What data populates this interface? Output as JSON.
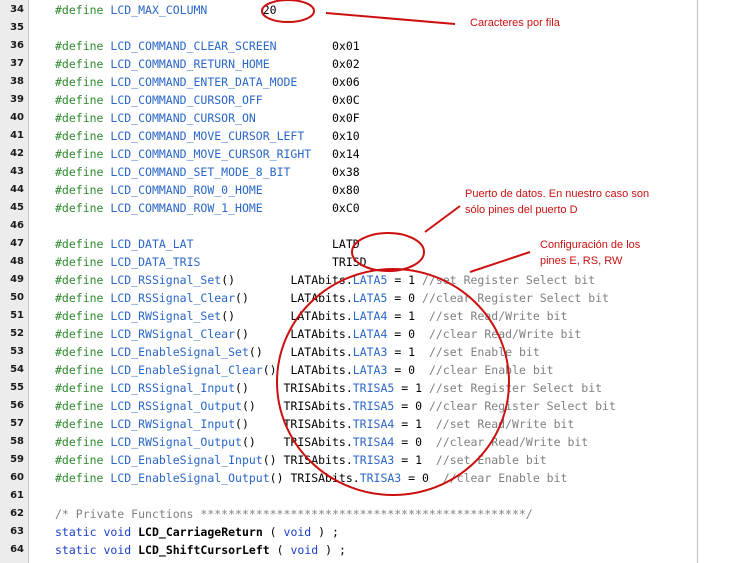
{
  "editor": {
    "lines": [
      {
        "num": "34",
        "parts": [
          [
            "def",
            "#define"
          ],
          [
            "txt",
            " "
          ],
          [
            "mac",
            "LCD_MAX_COLUMN"
          ],
          [
            "txt",
            "        "
          ],
          [
            "num",
            "20"
          ]
        ]
      },
      {
        "num": "35",
        "parts": []
      },
      {
        "num": "36",
        "parts": [
          [
            "def",
            "#define"
          ],
          [
            "txt",
            " "
          ],
          [
            "mac",
            "LCD_COMMAND_CLEAR_SCREEN"
          ],
          [
            "txt",
            "        "
          ],
          [
            "hex",
            "0x01"
          ]
        ]
      },
      {
        "num": "37",
        "parts": [
          [
            "def",
            "#define"
          ],
          [
            "txt",
            " "
          ],
          [
            "mac",
            "LCD_COMMAND_RETURN_HOME"
          ],
          [
            "txt",
            "         "
          ],
          [
            "hex",
            "0x02"
          ]
        ]
      },
      {
        "num": "38",
        "parts": [
          [
            "def",
            "#define"
          ],
          [
            "txt",
            " "
          ],
          [
            "mac",
            "LCD_COMMAND_ENTER_DATA_MODE"
          ],
          [
            "txt",
            "     "
          ],
          [
            "hex",
            "0x06"
          ]
        ]
      },
      {
        "num": "39",
        "parts": [
          [
            "def",
            "#define"
          ],
          [
            "txt",
            " "
          ],
          [
            "mac",
            "LCD_COMMAND_CURSOR_OFF"
          ],
          [
            "txt",
            "          "
          ],
          [
            "hex",
            "0x0C"
          ]
        ]
      },
      {
        "num": "40",
        "parts": [
          [
            "def",
            "#define"
          ],
          [
            "txt",
            " "
          ],
          [
            "mac",
            "LCD_COMMAND_CURSOR_ON"
          ],
          [
            "txt",
            "           "
          ],
          [
            "hex",
            "0x0F"
          ]
        ]
      },
      {
        "num": "41",
        "parts": [
          [
            "def",
            "#define"
          ],
          [
            "txt",
            " "
          ],
          [
            "mac",
            "LCD_COMMAND_MOVE_CURSOR_LEFT"
          ],
          [
            "txt",
            "    "
          ],
          [
            "hex",
            "0x10"
          ]
        ]
      },
      {
        "num": "42",
        "parts": [
          [
            "def",
            "#define"
          ],
          [
            "txt",
            " "
          ],
          [
            "mac",
            "LCD_COMMAND_MOVE_CURSOR_RIGHT"
          ],
          [
            "txt",
            "   "
          ],
          [
            "hex",
            "0x14"
          ]
        ]
      },
      {
        "num": "43",
        "parts": [
          [
            "def",
            "#define"
          ],
          [
            "txt",
            " "
          ],
          [
            "mac",
            "LCD_COMMAND_SET_MODE_8_BIT"
          ],
          [
            "txt",
            "      "
          ],
          [
            "hex",
            "0x38"
          ]
        ]
      },
      {
        "num": "44",
        "parts": [
          [
            "def",
            "#define"
          ],
          [
            "txt",
            " "
          ],
          [
            "mac",
            "LCD_COMMAND_ROW_0_HOME"
          ],
          [
            "txt",
            "          "
          ],
          [
            "hex",
            "0x80"
          ]
        ]
      },
      {
        "num": "45",
        "parts": [
          [
            "def",
            "#define"
          ],
          [
            "txt",
            " "
          ],
          [
            "mac",
            "LCD_COMMAND_ROW_1_HOME"
          ],
          [
            "txt",
            "          "
          ],
          [
            "hex",
            "0xC0"
          ]
        ]
      },
      {
        "num": "46",
        "parts": []
      },
      {
        "num": "47",
        "parts": [
          [
            "def",
            "#define"
          ],
          [
            "txt",
            " "
          ],
          [
            "mac",
            "LCD_DATA_LAT"
          ],
          [
            "txt",
            "                    "
          ],
          [
            "hex",
            "LATD"
          ]
        ]
      },
      {
        "num": "48",
        "parts": [
          [
            "def",
            "#define"
          ],
          [
            "txt",
            " "
          ],
          [
            "mac",
            "LCD_DATA_TRIS"
          ],
          [
            "txt",
            "                   "
          ],
          [
            "hex",
            "TRISD"
          ]
        ]
      },
      {
        "num": "49",
        "parts": [
          [
            "def",
            "#define"
          ],
          [
            "txt",
            " "
          ],
          [
            "mac",
            "LCD_RSSignal_Set"
          ],
          [
            "txt",
            "()        "
          ],
          [
            "reg",
            "LATAbits"
          ],
          [
            "op",
            "."
          ],
          [
            "fld",
            "LATA5"
          ],
          [
            "op",
            " = "
          ],
          [
            "num",
            "1"
          ],
          [
            "txt",
            " "
          ],
          [
            "cmt",
            "//set Register Select bit"
          ]
        ]
      },
      {
        "num": "50",
        "parts": [
          [
            "def",
            "#define"
          ],
          [
            "txt",
            " "
          ],
          [
            "mac",
            "LCD_RSSignal_Clear"
          ],
          [
            "txt",
            "()      "
          ],
          [
            "reg",
            "LATAbits"
          ],
          [
            "op",
            "."
          ],
          [
            "fld",
            "LATA5"
          ],
          [
            "op",
            " = "
          ],
          [
            "num",
            "0"
          ],
          [
            "txt",
            " "
          ],
          [
            "cmt",
            "//clear Register Select bit"
          ]
        ]
      },
      {
        "num": "51",
        "parts": [
          [
            "def",
            "#define"
          ],
          [
            "txt",
            " "
          ],
          [
            "mac",
            "LCD_RWSignal_Set"
          ],
          [
            "txt",
            "()        "
          ],
          [
            "reg",
            "LATAbits"
          ],
          [
            "op",
            "."
          ],
          [
            "fld",
            "LATA4"
          ],
          [
            "op",
            " = "
          ],
          [
            "num",
            "1"
          ],
          [
            "txt",
            "  "
          ],
          [
            "cmt",
            "//set Read/Write bit"
          ]
        ]
      },
      {
        "num": "52",
        "parts": [
          [
            "def",
            "#define"
          ],
          [
            "txt",
            " "
          ],
          [
            "mac",
            "LCD_RWSignal_Clear"
          ],
          [
            "txt",
            "()      "
          ],
          [
            "reg",
            "LATAbits"
          ],
          [
            "op",
            "."
          ],
          [
            "fld",
            "LATA4"
          ],
          [
            "op",
            " = "
          ],
          [
            "num",
            "0"
          ],
          [
            "txt",
            "  "
          ],
          [
            "cmt",
            "//clear Read/Write bit"
          ]
        ]
      },
      {
        "num": "53",
        "parts": [
          [
            "def",
            "#define"
          ],
          [
            "txt",
            " "
          ],
          [
            "mac",
            "LCD_EnableSignal_Set"
          ],
          [
            "txt",
            "()    "
          ],
          [
            "reg",
            "LATAbits"
          ],
          [
            "op",
            "."
          ],
          [
            "fld",
            "LATA3"
          ],
          [
            "op",
            " = "
          ],
          [
            "num",
            "1"
          ],
          [
            "txt",
            "  "
          ],
          [
            "cmt",
            "//set Enable bit"
          ]
        ]
      },
      {
        "num": "54",
        "parts": [
          [
            "def",
            "#define"
          ],
          [
            "txt",
            " "
          ],
          [
            "mac",
            "LCD_EnableSignal_Clear"
          ],
          [
            "txt",
            "()  "
          ],
          [
            "reg",
            "LATAbits"
          ],
          [
            "op",
            "."
          ],
          [
            "fld",
            "LATA3"
          ],
          [
            "op",
            " = "
          ],
          [
            "num",
            "0"
          ],
          [
            "txt",
            "  "
          ],
          [
            "cmt",
            "//clear Enable bit"
          ]
        ]
      },
      {
        "num": "55",
        "parts": [
          [
            "def",
            "#define"
          ],
          [
            "txt",
            " "
          ],
          [
            "mac",
            "LCD_RSSignal_Input"
          ],
          [
            "txt",
            "()     "
          ],
          [
            "reg",
            "TRISAbits"
          ],
          [
            "op",
            "."
          ],
          [
            "fld",
            "TRISA5"
          ],
          [
            "op",
            " = "
          ],
          [
            "num",
            "1"
          ],
          [
            "txt",
            " "
          ],
          [
            "cmt",
            "//set Register Select bit"
          ]
        ]
      },
      {
        "num": "56",
        "parts": [
          [
            "def",
            "#define"
          ],
          [
            "txt",
            " "
          ],
          [
            "mac",
            "LCD_RSSignal_Output"
          ],
          [
            "txt",
            "()    "
          ],
          [
            "reg",
            "TRISAbits"
          ],
          [
            "op",
            "."
          ],
          [
            "fld",
            "TRISA5"
          ],
          [
            "op",
            " = "
          ],
          [
            "num",
            "0"
          ],
          [
            "txt",
            " "
          ],
          [
            "cmt",
            "//clear Register Select bit"
          ]
        ]
      },
      {
        "num": "57",
        "parts": [
          [
            "def",
            "#define"
          ],
          [
            "txt",
            " "
          ],
          [
            "mac",
            "LCD_RWSignal_Input"
          ],
          [
            "txt",
            "()     "
          ],
          [
            "reg",
            "TRISAbits"
          ],
          [
            "op",
            "."
          ],
          [
            "fld",
            "TRISA4"
          ],
          [
            "op",
            " = "
          ],
          [
            "num",
            "1"
          ],
          [
            "txt",
            "  "
          ],
          [
            "cmt",
            "//set Read/Write bit"
          ]
        ]
      },
      {
        "num": "58",
        "parts": [
          [
            "def",
            "#define"
          ],
          [
            "txt",
            " "
          ],
          [
            "mac",
            "LCD_RWSignal_Output"
          ],
          [
            "txt",
            "()    "
          ],
          [
            "reg",
            "TRISAbits"
          ],
          [
            "op",
            "."
          ],
          [
            "fld",
            "TRISA4"
          ],
          [
            "op",
            " = "
          ],
          [
            "num",
            "0"
          ],
          [
            "txt",
            "  "
          ],
          [
            "cmt",
            "//clear Read/Write bit"
          ]
        ]
      },
      {
        "num": "59",
        "parts": [
          [
            "def",
            "#define"
          ],
          [
            "txt",
            " "
          ],
          [
            "mac",
            "LCD_EnableSignal_Input"
          ],
          [
            "txt",
            "() "
          ],
          [
            "reg",
            "TRISAbits"
          ],
          [
            "op",
            "."
          ],
          [
            "fld",
            "TRISA3"
          ],
          [
            "op",
            " = "
          ],
          [
            "num",
            "1"
          ],
          [
            "txt",
            "  "
          ],
          [
            "cmt",
            "//set Enable bit"
          ]
        ]
      },
      {
        "num": "60",
        "parts": [
          [
            "def",
            "#define"
          ],
          [
            "txt",
            " "
          ],
          [
            "mac",
            "LCD_EnableSignal_Output"
          ],
          [
            "txt",
            "() "
          ],
          [
            "reg",
            "TRISAbits"
          ],
          [
            "op",
            "."
          ],
          [
            "fld",
            "TRISA3"
          ],
          [
            "op",
            " = "
          ],
          [
            "num",
            "0"
          ],
          [
            "txt",
            "  "
          ],
          [
            "cmt",
            "//clear Enable bit"
          ]
        ]
      },
      {
        "num": "61",
        "parts": []
      },
      {
        "num": "62",
        "parts": [
          [
            "cmt",
            "/* Private Functions ***********************************************/"
          ]
        ]
      },
      {
        "num": "63",
        "parts": [
          [
            "kw",
            "static"
          ],
          [
            "txt",
            " "
          ],
          [
            "kw",
            "void"
          ],
          [
            "txt",
            " "
          ],
          [
            "fn",
            "LCD_CarriageReturn"
          ],
          [
            "txt",
            " ( "
          ],
          [
            "kw",
            "void"
          ],
          [
            "txt",
            " ) ;"
          ]
        ]
      },
      {
        "num": "64",
        "parts": [
          [
            "kw",
            "static"
          ],
          [
            "txt",
            " "
          ],
          [
            "kw",
            "void"
          ],
          [
            "txt",
            " "
          ],
          [
            "fn",
            "LCD_ShiftCursorLeft"
          ],
          [
            "txt",
            " ( "
          ],
          [
            "kw",
            "void"
          ],
          [
            "txt",
            " ) ;"
          ]
        ]
      }
    ]
  },
  "annotations": {
    "caracteres": "Caracteres por fila",
    "puerto_line1": "Puerto de datos. En nuestro caso son",
    "puerto_line2": "sólo pines del puerto D",
    "config_line1": "Configuración de los",
    "config_line2": "pines E, RS, RW"
  },
  "colors": {
    "annotation_red": "#cc1010",
    "define_green": "#2e8b2e",
    "macro_blue": "#2a67c8",
    "comment_gray": "#808080"
  }
}
